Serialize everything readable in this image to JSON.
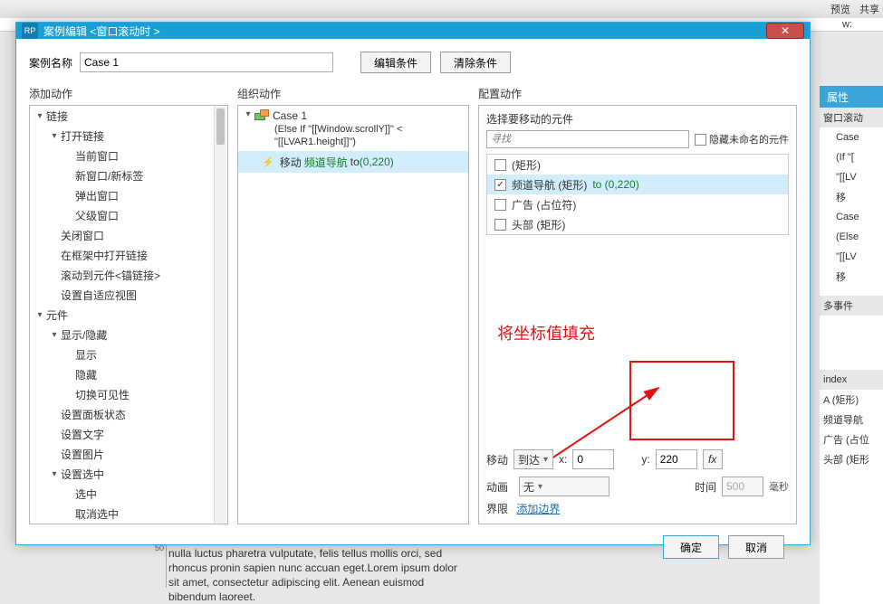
{
  "bg": {
    "top_right": [
      "预览",
      "共享"
    ],
    "w_label": "w:",
    "right_tab": "属性",
    "right_lines": [
      "窗口滚动",
      "Case",
      "(If \"[",
      "\"[[LV",
      "移",
      "Case",
      "(Else",
      "\"[[LV",
      "移",
      "多事件",
      "index",
      "A  (矩形)",
      "频道导航",
      "广告 (占位",
      "头部 (矩形"
    ],
    "lorem": "nulla luctus pharetra vulputate, felis tellus mollis orci, sed rhoncus pronin sapien nunc accuan eget.Lorem ipsum dolor sit amet, consectetur adipiscing elit. Aenean euismod bibendum laoreet.",
    "ruler_tick": "50"
  },
  "dialog": {
    "title": "案例编辑 <窗口滚动时  >",
    "icon_text": "RP",
    "name_label": "案例名称",
    "name_value": "Case 1",
    "btn_edit_cond": "编辑条件",
    "btn_clear_cond": "清除条件",
    "col1_title": "添加动作",
    "col2_title": "组织动作",
    "col3_title": "配置动作",
    "ok": "确定",
    "cancel": "取消"
  },
  "actions_tree": [
    {
      "label": "链接",
      "caret": "open",
      "indent": 0
    },
    {
      "label": "打开链接",
      "caret": "open",
      "indent": 1
    },
    {
      "label": "当前窗口",
      "caret": "none",
      "indent": 2
    },
    {
      "label": "新窗口/新标签",
      "caret": "none",
      "indent": 2
    },
    {
      "label": "弹出窗口",
      "caret": "none",
      "indent": 2
    },
    {
      "label": "父级窗口",
      "caret": "none",
      "indent": 2
    },
    {
      "label": "关闭窗口",
      "caret": "none",
      "indent": 1
    },
    {
      "label": "在框架中打开链接",
      "caret": "none",
      "indent": 1
    },
    {
      "label": "滚动到元件<锚链接>",
      "caret": "none",
      "indent": 1
    },
    {
      "label": "设置自适应视图",
      "caret": "none",
      "indent": 1
    },
    {
      "label": "元件",
      "caret": "open",
      "indent": 0
    },
    {
      "label": "显示/隐藏",
      "caret": "open",
      "indent": 1
    },
    {
      "label": "显示",
      "caret": "none",
      "indent": 2
    },
    {
      "label": "隐藏",
      "caret": "none",
      "indent": 2
    },
    {
      "label": "切换可见性",
      "caret": "none",
      "indent": 2
    },
    {
      "label": "设置面板状态",
      "caret": "none",
      "indent": 1
    },
    {
      "label": "设置文字",
      "caret": "none",
      "indent": 1
    },
    {
      "label": "设置图片",
      "caret": "none",
      "indent": 1
    },
    {
      "label": "设置选中",
      "caret": "open",
      "indent": 1
    },
    {
      "label": "选中",
      "caret": "none",
      "indent": 2
    },
    {
      "label": "取消选中",
      "caret": "none",
      "indent": 2
    }
  ],
  "case": {
    "name": "Case 1",
    "cond1": "(Else If \"[[Window.scrollY]]\" <",
    "cond2": "\"[[LVAR1.height]]\")",
    "move_label": "移动",
    "move_target": "频道导航",
    "move_to": "to",
    "move_coord": "(0,220)"
  },
  "config": {
    "select_title": "选择要移动的元件",
    "search_placeholder": "寻找",
    "hide_unnamed": "隐藏未命名的元件",
    "widgets": [
      {
        "name": "(矩形)",
        "checked": false,
        "sel": false,
        "to": ""
      },
      {
        "name": "频道导航 (矩形)",
        "checked": true,
        "sel": true,
        "to": "to (0,220)"
      },
      {
        "name": "广告 (占位符)",
        "checked": false,
        "sel": false,
        "to": ""
      },
      {
        "name": "头部 (矩形)",
        "checked": false,
        "sel": false,
        "to": ""
      }
    ],
    "annotation": "将坐标值填充",
    "move_label": "移动",
    "move_mode": "到达",
    "x_label": "x:",
    "x_value": "0",
    "y_label": "y:",
    "y_value": "220",
    "fx_label": "fx",
    "anim_label": "动画",
    "anim_mode": "无",
    "time_label": "时间",
    "time_value": "500",
    "ms": "毫秒",
    "bounds_label": "界限",
    "bounds_link": "添加边界"
  }
}
